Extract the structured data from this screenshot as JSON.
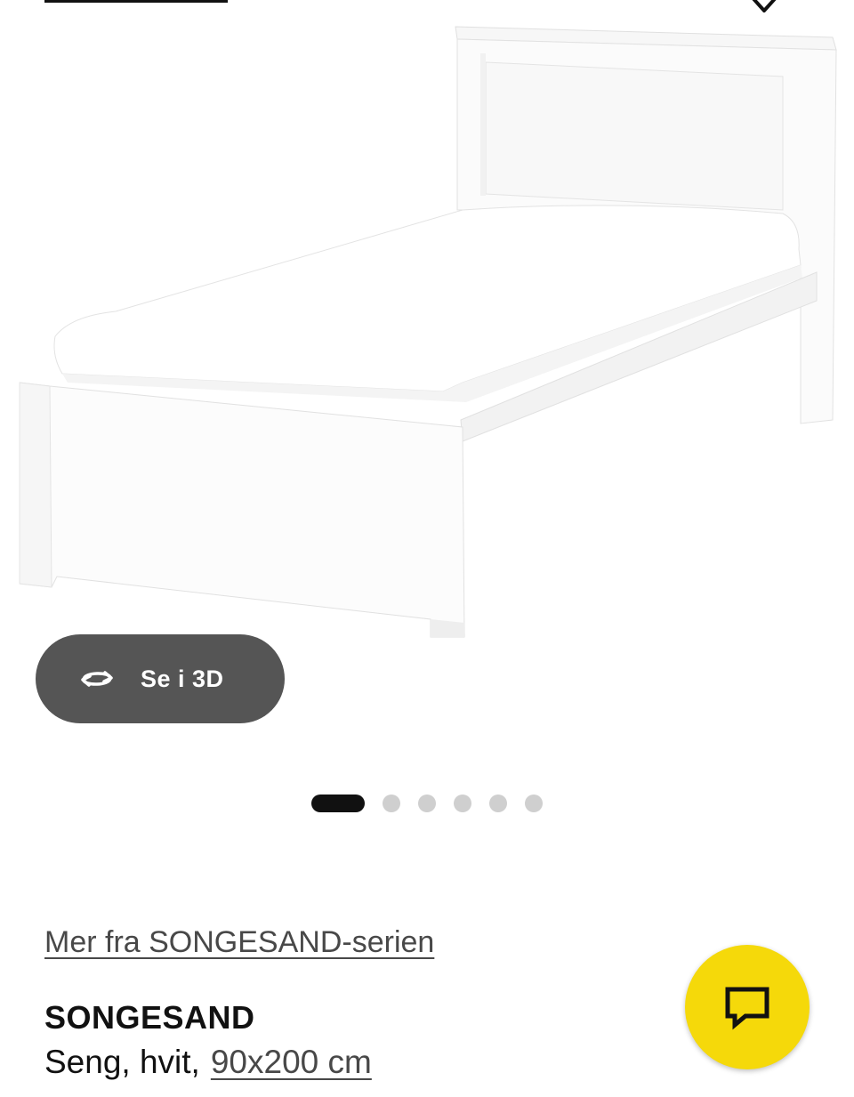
{
  "gallery": {
    "view_3d_label": "Se i 3D",
    "slide_count": 6,
    "active_slide": 1
  },
  "product": {
    "series_link": "Mer fra SONGESAND-serien",
    "name": "SONGESAND",
    "description_prefix": "Seng, hvit,",
    "size_link": "90x200 cm"
  },
  "icons": {
    "favorite": "heart-icon",
    "view_3d": "rotate-3d-icon",
    "chat": "chat-bubble-icon"
  },
  "colors": {
    "chat_button": "#f5d90a",
    "view_3d_button": "#555555",
    "pager_active": "#111111",
    "pager_inactive": "#cfcfcf"
  }
}
